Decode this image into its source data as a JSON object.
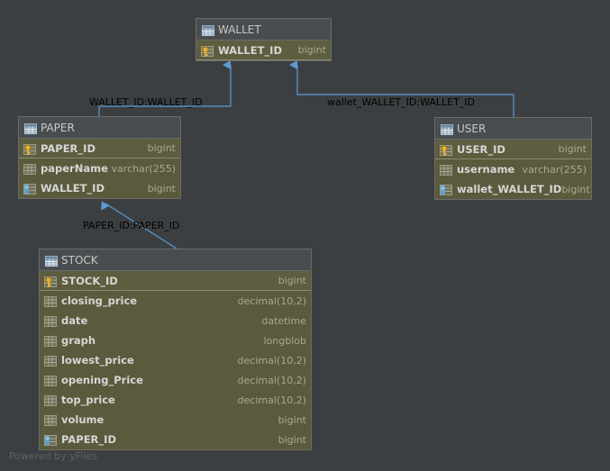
{
  "tables": {
    "wallet": {
      "name": "WALLET",
      "columns": [
        {
          "name": "WALLET_ID",
          "type": "bigint",
          "icon": "primary-key-icon"
        }
      ]
    },
    "paper": {
      "name": "PAPER",
      "columns": [
        {
          "name": "PAPER_ID",
          "type": "bigint",
          "icon": "primary-key-icon"
        },
        {
          "name": "paperName",
          "type": "varchar(255)",
          "icon": "column-icon"
        },
        {
          "name": "WALLET_ID",
          "type": "bigint",
          "icon": "foreign-key-icon"
        }
      ]
    },
    "user": {
      "name": "USER",
      "columns": [
        {
          "name": "USER_ID",
          "type": "bigint",
          "icon": "primary-key-icon"
        },
        {
          "name": "username",
          "type": "varchar(255)",
          "icon": "column-icon"
        },
        {
          "name": "wallet_WALLET_ID",
          "type": "bigint",
          "icon": "foreign-key-icon"
        }
      ]
    },
    "stock": {
      "name": "STOCK",
      "columns": [
        {
          "name": "STOCK_ID",
          "type": "bigint",
          "icon": "primary-key-icon"
        },
        {
          "name": "closing_price",
          "type": "decimal(10,2)",
          "icon": "column-icon"
        },
        {
          "name": "date",
          "type": "datetime",
          "icon": "column-icon"
        },
        {
          "name": "graph",
          "type": "longblob",
          "icon": "column-icon"
        },
        {
          "name": "lowest_price",
          "type": "decimal(10,2)",
          "icon": "column-icon"
        },
        {
          "name": "opening_Price",
          "type": "decimal(10,2)",
          "icon": "column-icon"
        },
        {
          "name": "top_price",
          "type": "decimal(10,2)",
          "icon": "column-icon"
        },
        {
          "name": "volume",
          "type": "bigint",
          "icon": "column-icon"
        },
        {
          "name": "PAPER_ID",
          "type": "bigint",
          "icon": "foreign-key-icon"
        }
      ]
    }
  },
  "relations": [
    {
      "label": "WALLET_ID:WALLET_ID",
      "from": "PAPER",
      "to": "WALLET"
    },
    {
      "label": "wallet_WALLET_ID:WALLET_ID",
      "from": "USER",
      "to": "WALLET"
    },
    {
      "label": "PAPER_ID:PAPER_ID",
      "from": "STOCK",
      "to": "PAPER"
    }
  ],
  "watermark": "Powered by yFiles",
  "colors": {
    "background": "#3c3f41",
    "edge": "#5b9bd5",
    "table_body": "#5a5a3d",
    "table_header": "#4a4d4f"
  }
}
